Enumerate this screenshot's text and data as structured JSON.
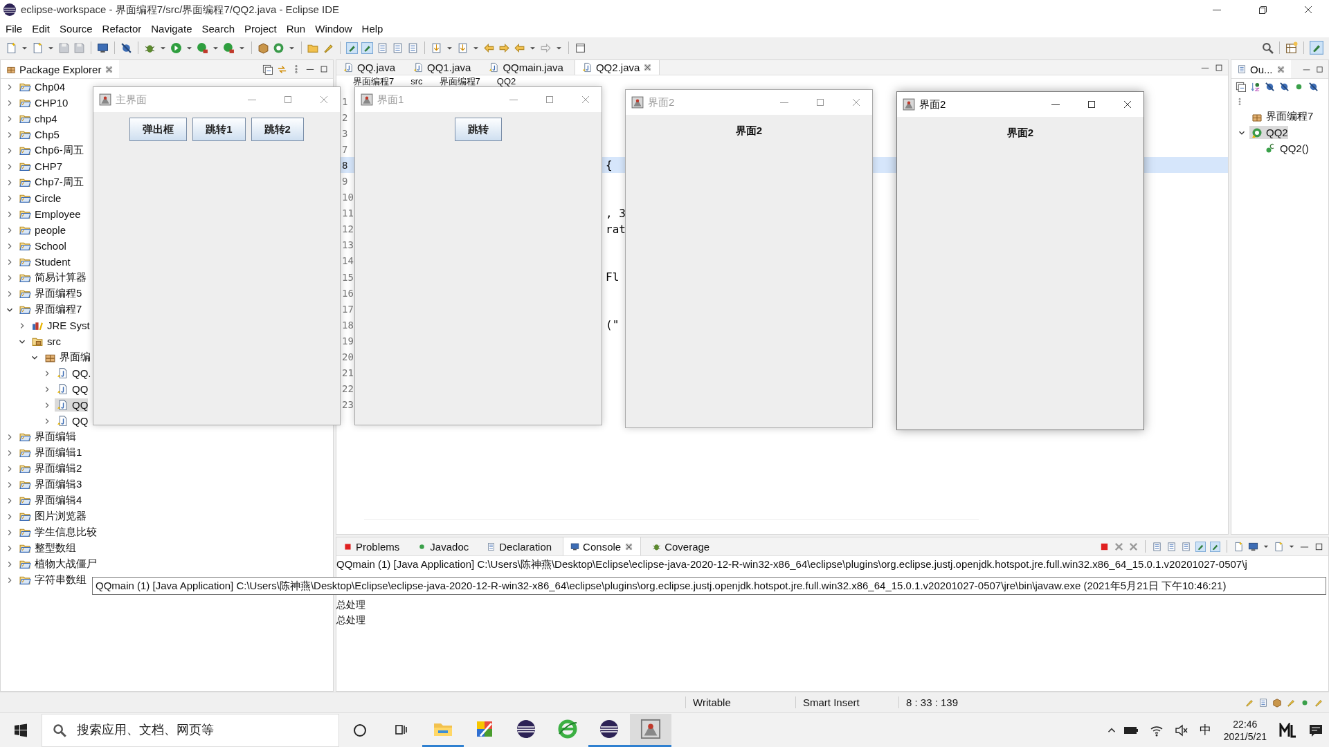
{
  "window": {
    "title": "eclipse-workspace - 界面编程7/src/界面编程7/QQ2.java - Eclipse IDE"
  },
  "menu": [
    "File",
    "Edit",
    "Source",
    "Refactor",
    "Navigate",
    "Search",
    "Project",
    "Run",
    "Window",
    "Help"
  ],
  "package_explorer": {
    "title": "Package Explorer",
    "tree": [
      {
        "label": "Chp04",
        "kind": "project",
        "expanded": false,
        "selected": false
      },
      {
        "label": "CHP10",
        "kind": "project",
        "expanded": false,
        "selected": false
      },
      {
        "label": "chp4",
        "kind": "project",
        "expanded": false,
        "selected": false
      },
      {
        "label": "Chp5",
        "kind": "project",
        "expanded": false,
        "selected": false
      },
      {
        "label": "Chp6-周五",
        "kind": "project",
        "expanded": false,
        "selected": false
      },
      {
        "label": "CHP7",
        "kind": "project",
        "expanded": false,
        "selected": false
      },
      {
        "label": "Chp7-周五",
        "kind": "project",
        "expanded": false,
        "selected": false
      },
      {
        "label": "Circle",
        "kind": "project",
        "expanded": false,
        "selected": false
      },
      {
        "label": "Employee",
        "kind": "project",
        "expanded": false,
        "selected": false
      },
      {
        "label": "people",
        "kind": "project",
        "expanded": false,
        "selected": false
      },
      {
        "label": "School",
        "kind": "project",
        "expanded": false,
        "selected": false
      },
      {
        "label": "Student",
        "kind": "project",
        "expanded": false,
        "selected": false
      },
      {
        "label": "简易计算器",
        "kind": "project",
        "expanded": false,
        "selected": false
      },
      {
        "label": "界面编程5",
        "kind": "project",
        "expanded": false,
        "selected": false
      },
      {
        "label": "界面编程7",
        "kind": "project",
        "expanded": true,
        "selected": false,
        "children": [
          {
            "label": "JRE Syst",
            "kind": "library",
            "expanded": false,
            "selected": false
          },
          {
            "label": "src",
            "kind": "source",
            "expanded": true,
            "selected": false,
            "children": [
              {
                "label": "界面编",
                "kind": "package",
                "expanded": true,
                "selected": false,
                "children": [
                  {
                    "label": "QQ.",
                    "kind": "java",
                    "expanded": false,
                    "selected": false
                  },
                  {
                    "label": "QQ",
                    "kind": "java",
                    "expanded": false,
                    "selected": false
                  },
                  {
                    "label": "QQ",
                    "kind": "java",
                    "expanded": false,
                    "selected": true
                  },
                  {
                    "label": "QQ",
                    "kind": "java",
                    "expanded": false,
                    "selected": false
                  }
                ]
              }
            ]
          }
        ]
      },
      {
        "label": "界面编辑",
        "kind": "project",
        "expanded": false,
        "selected": false
      },
      {
        "label": "界面编辑1",
        "kind": "project",
        "expanded": false,
        "selected": false
      },
      {
        "label": "界面编辑2",
        "kind": "project",
        "expanded": false,
        "selected": false
      },
      {
        "label": "界面编辑3",
        "kind": "project",
        "expanded": false,
        "selected": false
      },
      {
        "label": "界面编辑4",
        "kind": "project",
        "expanded": false,
        "selected": false
      },
      {
        "label": "图片浏览器",
        "kind": "project",
        "expanded": false,
        "selected": false
      },
      {
        "label": "学生信息比较",
        "kind": "project",
        "expanded": false,
        "selected": false
      },
      {
        "label": "整型数组",
        "kind": "project",
        "expanded": false,
        "selected": false
      },
      {
        "label": "植物大战僵尸",
        "kind": "project",
        "expanded": false,
        "selected": false
      },
      {
        "label": "字符串数组",
        "kind": "project",
        "expanded": false,
        "selected": false
      }
    ]
  },
  "editor": {
    "tabs": [
      {
        "label": "QQ.java",
        "selected": false
      },
      {
        "label": "QQ1.java",
        "selected": false
      },
      {
        "label": "QQmain.java",
        "selected": false
      },
      {
        "label": "QQ2.java",
        "selected": true
      }
    ],
    "breadcrumb": [
      "界面编程7",
      "src",
      "界面编程7",
      "QQ2"
    ],
    "lines": [
      {
        "number": "1",
        "current": false
      },
      {
        "number": "2",
        "current": false
      },
      {
        "number": "3",
        "current": false
      },
      {
        "number": "7",
        "current": false
      },
      {
        "number": "8",
        "current": true,
        "code": "{"
      },
      {
        "number": "9",
        "current": false
      },
      {
        "number": "10",
        "current": false
      },
      {
        "number": "11",
        "current": false,
        "code": ", 3"
      },
      {
        "number": "12",
        "current": false,
        "code": "rat"
      },
      {
        "number": "13",
        "current": false
      },
      {
        "number": "14",
        "current": false
      },
      {
        "number": "15",
        "current": false,
        "code": "Fl"
      },
      {
        "number": "16",
        "current": false
      },
      {
        "number": "17",
        "current": false
      },
      {
        "number": "18",
        "current": false,
        "code": "(\""
      },
      {
        "number": "19",
        "current": false
      },
      {
        "number": "20",
        "current": false
      },
      {
        "number": "21",
        "current": false
      },
      {
        "number": "22",
        "current": false
      },
      {
        "number": "23",
        "current": false
      }
    ]
  },
  "outline": {
    "title": "Ou...",
    "tree": [
      {
        "label": "界面编程7",
        "kind": "package",
        "selected": false
      },
      {
        "label": "QQ2",
        "kind": "class",
        "selected": true,
        "expanded": true,
        "children": [
          {
            "label": "QQ2()",
            "kind": "constructor",
            "selected": false
          }
        ]
      }
    ]
  },
  "console": {
    "tabs": [
      {
        "label": "Problems",
        "selected": false
      },
      {
        "label": "Javadoc",
        "selected": false
      },
      {
        "label": "Declaration",
        "selected": false
      },
      {
        "label": "Console",
        "selected": true
      },
      {
        "label": "Coverage",
        "selected": false
      }
    ],
    "header": "QQmain (1) [Java Application] C:\\Users\\陈神燕\\Desktop\\Eclipse\\eclipse-java-2020-12-R-win32-x86_64\\eclipse\\plugins\\org.eclipse.justj.openjdk.hotspot.jre.full.win32.x86_64_15.0.1.v20201027-0507\\j",
    "lines": [
      "总处理",
      "总处理"
    ],
    "tooltip": "QQmain (1) [Java Application] C:\\Users\\陈神燕\\Desktop\\Eclipse\\eclipse-java-2020-12-R-win32-x86_64\\eclipse\\plugins\\org.eclipse.justj.openjdk.hotspot.jre.full.win32.x86_64_15.0.1.v20201027-0507\\jre\\bin\\javaw.exe  (2021年5月21日 下午10:46:21)"
  },
  "status_bar": [
    "Writable",
    "Smart Insert",
    "8 : 33 : 139"
  ],
  "frames": [
    {
      "title": "主界面",
      "active": false,
      "content": [
        {
          "kind": "button",
          "label": "弹出框"
        },
        {
          "kind": "button",
          "label": "跳转1"
        },
        {
          "kind": "button",
          "label": "跳转2"
        }
      ]
    },
    {
      "title": "界面1",
      "active": false,
      "content": [
        {
          "kind": "button",
          "label": "跳转"
        }
      ]
    },
    {
      "title": "界面2",
      "active": false,
      "content": [
        {
          "kind": "label",
          "label": "界面2"
        }
      ]
    },
    {
      "title": "界面2",
      "active": true,
      "content": [
        {
          "kind": "label",
          "label": "界面2"
        }
      ]
    }
  ],
  "taskbar": {
    "search": {
      "placeholder": "搜索应用、文档、网页等"
    },
    "apps": [
      {
        "kind": "explorer",
        "running": true,
        "selected": false
      },
      {
        "kind": "paint",
        "running": false,
        "selected": false
      },
      {
        "kind": "eclipse",
        "running": false,
        "selected": false
      },
      {
        "kind": "browser",
        "running": false,
        "selected": false
      },
      {
        "kind": "eclipse",
        "running": true,
        "selected": false
      },
      {
        "kind": "java",
        "running": true,
        "selected": true
      }
    ],
    "input_method": "中",
    "time": "22:46",
    "date": "2021/5/21"
  }
}
